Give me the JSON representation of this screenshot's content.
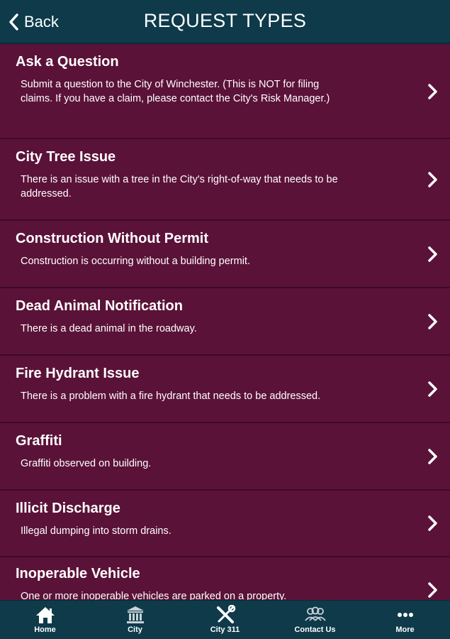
{
  "header": {
    "back_label": "Back",
    "title": "REQUEST TYPES"
  },
  "colors": {
    "header_bg": "#0e3a4a",
    "list_bg": "#5b1238",
    "divider": "#3a0c24",
    "text": "#ffffff"
  },
  "request_types": [
    {
      "title": "Ask a Question",
      "description": "Submit a question to the City of Winchester. (This is NOT for filing claims. If you have a claim, please contact the City's Risk Manager.)"
    },
    {
      "title": "City Tree Issue",
      "description": "There is an issue with a tree in the City's right-of-way that needs to be addressed."
    },
    {
      "title": "Construction Without Permit",
      "description": "Construction is occurring without a building permit."
    },
    {
      "title": "Dead Animal Notification",
      "description": "There is a dead animal in the roadway."
    },
    {
      "title": "Fire Hydrant Issue",
      "description": "There is a problem with a fire hydrant that needs to be addressed."
    },
    {
      "title": "Graffiti",
      "description": "Graffiti observed on building."
    },
    {
      "title": "Illicit Discharge",
      "description": "Illegal dumping into storm drains."
    },
    {
      "title": "Inoperable Vehicle",
      "description": "One or more inoperable vehicles are parked on a property."
    }
  ],
  "tabbar": {
    "items": [
      {
        "label": "Home",
        "icon": "home-icon"
      },
      {
        "label": "City",
        "icon": "city-hall-icon"
      },
      {
        "label": "City 311",
        "icon": "tools-icon"
      },
      {
        "label": "Contact Us",
        "icon": "people-icon"
      },
      {
        "label": "More",
        "icon": "more-icon"
      }
    ]
  }
}
